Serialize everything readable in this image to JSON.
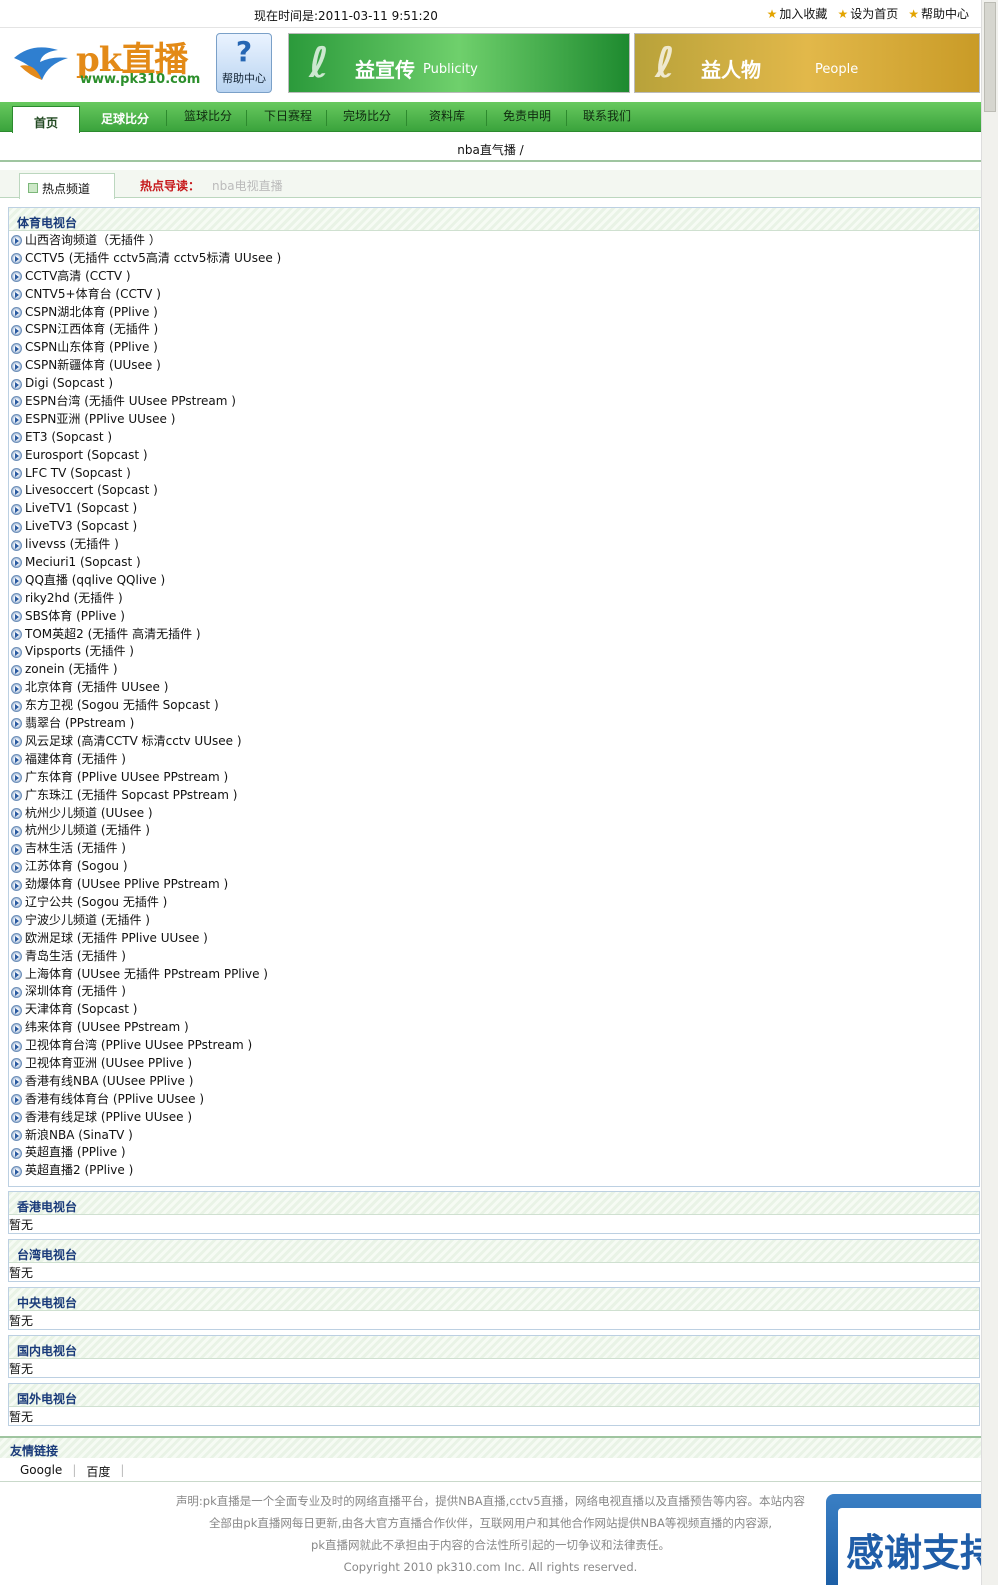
{
  "topbar": {
    "time_text": "现在时间是:2011-03-11 9:51:20",
    "links": [
      "加入收藏",
      "设为首页",
      "帮助中心"
    ]
  },
  "header": {
    "brand": "pk直播",
    "url": "www.pk310.com",
    "help_label": "帮助中心",
    "banner1_title": "益宣传",
    "banner1_sub": "Publicity",
    "banner2_title": "益人物",
    "banner2_sub": "People"
  },
  "nav": {
    "items": [
      "首页",
      "足球比分",
      "篮球比分",
      "下日赛程",
      "完场比分",
      "资料库",
      "免责申明",
      "联系我们"
    ]
  },
  "breadcrumb": "nba直气播 /",
  "hotbar": {
    "tab": "热点频道",
    "label": "热点导读：",
    "link": "nba电视直播"
  },
  "sections": [
    {
      "title": "体育电视台",
      "items": [
        "山西咨询频道（无插件 ）",
        "CCTV5 (无插件 cctv5高清 cctv5标清 UUsee )",
        "CCTV高清 (CCTV )",
        "CNTV5+体育台 (CCTV )",
        "CSPN湖北体育 (PPlive )",
        "CSPN江西体育 (无插件 )",
        "CSPN山东体育 (PPlive )",
        "CSPN新疆体育 (UUsee )",
        "Digi (Sopcast )",
        "ESPN台湾 (无插件 UUsee PPstream )",
        "ESPN亚洲 (PPlive UUsee )",
        "ET3 (Sopcast )",
        "Eurosport (Sopcast )",
        "LFC TV (Sopcast )",
        "Livesoccert (Sopcast )",
        "LiveTV1 (Sopcast )",
        "LiveTV3 (Sopcast )",
        "livevss (无插件 )",
        "Meciuri1 (Sopcast )",
        "QQ直播 (qqlive QQlive )",
        "riky2hd (无插件 )",
        "SBS体育 (PPlive )",
        "TOM英超2 (无插件 高清无插件 )",
        "Vipsports (无插件 )",
        "zonein (无插件 )",
        "北京体育 (无插件 UUsee )",
        "东方卫视 (Sogou 无插件 Sopcast )",
        "翡翠台 (PPstream )",
        "风云足球 (高清CCTV 标清cctv UUsee )",
        "福建体育 (无插件 )",
        "广东体育 (PPlive UUsee PPstream )",
        "广东珠江 (无插件 Sopcast PPstream )",
        "杭州少儿频道 (UUsee )",
        "杭州少儿频道 (无插件 )",
        "吉林生活 (无插件 )",
        "江苏体育 (Sogou )",
        "劲爆体育 (UUsee PPlive PPstream )",
        "辽宁公共 (Sogou 无插件 )",
        "宁波少儿频道 (无插件 )",
        "欧洲足球 (无插件 PPlive UUsee )",
        "青岛生活 (无插件 )",
        "上海体育 (UUsee 无插件 PPstream PPlive )",
        "深圳体育 (无插件 )",
        "天津体育 (Sopcast )",
        "纬来体育 (UUsee PPstream )",
        "卫视体育台湾 (PPlive UUsee PPstream )",
        "卫视体育亚洲 (UUsee PPlive )",
        "香港有线NBA (UUsee PPlive )",
        "香港有线体育台 (PPlive UUsee )",
        "香港有线足球 (PPlive UUsee )",
        "新浪NBA (SinaTV )",
        "英超直播 (PPlive )",
        "英超直播2 (PPlive )"
      ]
    },
    {
      "title": "香港电视台",
      "empty": "暂无"
    },
    {
      "title": "台湾电视台",
      "empty": "暂无"
    },
    {
      "title": "中央电视台",
      "empty": "暂无"
    },
    {
      "title": "国内电视台",
      "empty": "暂无"
    },
    {
      "title": "国外电视台",
      "empty": "暂无"
    }
  ],
  "friends": {
    "title": "友情链接",
    "links": [
      "Google",
      "百度"
    ]
  },
  "footer": {
    "line1": "声明:pk直播是一个全面专业及时的网络直播平台，提供NBA直播,cctv5直播，网络电视直播以及直播预告等内容。本站内容",
    "line2": "全部由pk直播网每日更新,由各大官方直播合作伙伴，互联网用户和其他合作网站提供NBA等视频直播的内容源,",
    "line3": "pk直播网就此不承担由于内容的合法性所引起的一切争议和法律责任。",
    "line4": "Copyright 2010 pk310.com Inc. All rights reserved."
  },
  "float_box": {
    "text": "感谢支持"
  }
}
